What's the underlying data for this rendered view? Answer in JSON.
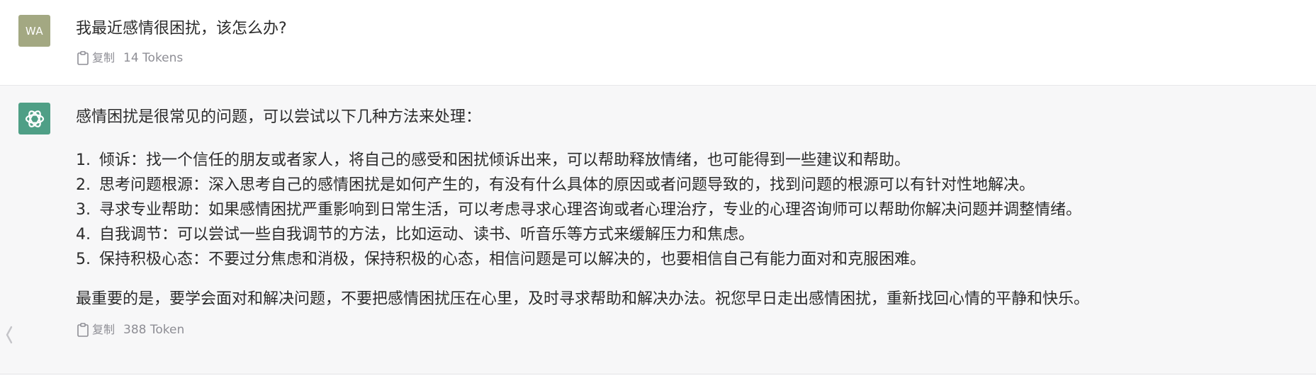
{
  "user_message": {
    "avatar_initials": "WA",
    "text": "我最近感情很困扰，该怎么办?",
    "actions": {
      "copy_label": "复制",
      "tokens": "14 Tokens"
    }
  },
  "assistant_message": {
    "avatar_icon": "chatgpt-logo-icon",
    "intro": "感情困扰是很常见的问题，可以尝试以下几种方法来处理：",
    "list": [
      {
        "num": "1.",
        "text": "倾诉：找一个信任的朋友或者家人，将自己的感受和困扰倾诉出来，可以帮助释放情绪，也可能得到一些建议和帮助。"
      },
      {
        "num": "2.",
        "text": "思考问题根源：深入思考自己的感情困扰是如何产生的，有没有什么具体的原因或者问题导致的，找到问题的根源可以有针对性地解决。"
      },
      {
        "num": "3.",
        "text": "寻求专业帮助：如果感情困扰严重影响到日常生活，可以考虑寻求心理咨询或者心理治疗，专业的心理咨询师可以帮助你解决问题并调整情绪。"
      },
      {
        "num": "4.",
        "text": "自我调节：可以尝试一些自我调节的方法，比如运动、读书、听音乐等方式来缓解压力和焦虑。"
      },
      {
        "num": "5.",
        "text": "保持积极心态：不要过分焦虑和消极，保持积极的心态，相信问题是可以解决的，也要相信自己有能力面对和克服困难。"
      }
    ],
    "closing": "最重要的是，要学会面对和解决问题，不要把感情困扰压在心里，及时寻求帮助和解决办法。祝您早日走出感情困扰，重新找回心情的平静和快乐。",
    "actions": {
      "copy_label": "复制",
      "tokens": "388 Token"
    }
  },
  "colors": {
    "user_avatar_bg": "#a3a882",
    "bot_avatar_bg": "#4f9f86",
    "bot_message_bg": "#f7f7f8",
    "muted_text": "#8e8e95"
  }
}
